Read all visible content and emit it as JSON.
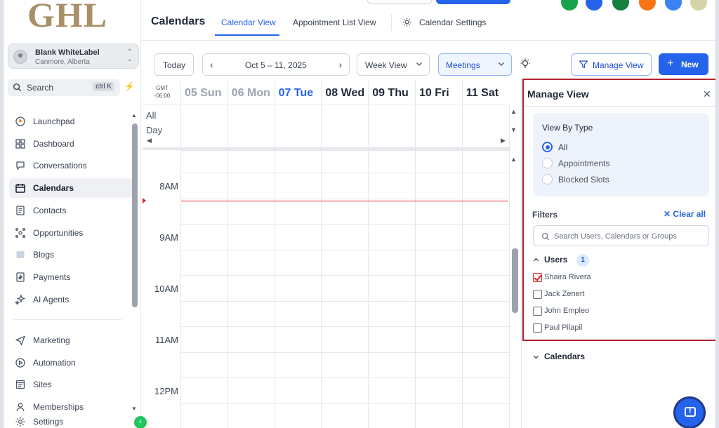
{
  "brand": {
    "logo_text": "GHL"
  },
  "account": {
    "name": "Blank WhiteLabel",
    "location": "Canmore, Alberta"
  },
  "search": {
    "label": "Search",
    "shortcut": "ctrl K"
  },
  "sidebar": {
    "items": [
      {
        "label": "Launchpad",
        "icon": "rocket-icon"
      },
      {
        "label": "Dashboard",
        "icon": "grid-icon"
      },
      {
        "label": "Conversations",
        "icon": "chat-bubble-icon"
      },
      {
        "label": "Calendars",
        "icon": "calendar-icon",
        "active": true
      },
      {
        "label": "Contacts",
        "icon": "contacts-icon"
      },
      {
        "label": "Opportunities",
        "icon": "opportunities-icon"
      },
      {
        "label": "Blogs",
        "icon": "blog-icon"
      },
      {
        "label": "Payments",
        "icon": "payments-icon"
      },
      {
        "label": "AI Agents",
        "icon": "sparkle-icon"
      }
    ],
    "items2": [
      {
        "label": "Marketing",
        "icon": "send-icon"
      },
      {
        "label": "Automation",
        "icon": "automation-icon"
      },
      {
        "label": "Sites",
        "icon": "sites-icon"
      },
      {
        "label": "Memberships",
        "icon": "memberships-icon"
      },
      {
        "label": "Settings",
        "icon": "gear-icon"
      }
    ]
  },
  "header": {
    "title": "Calendars",
    "tabs": [
      {
        "label": "Calendar View",
        "active": true
      },
      {
        "label": "Appointment List View"
      },
      {
        "label": "Calendar Settings"
      }
    ]
  },
  "toolbar": {
    "today": "Today",
    "date_range": "Oct 5 – 11, 2025",
    "view": "Week View",
    "filter": "Meetings",
    "manage_view": "Manage View",
    "new": "New"
  },
  "calendar": {
    "timezone_line1": "GMT",
    "timezone_line2": "-06:00",
    "days": [
      {
        "label": "05 Sun",
        "state": "past"
      },
      {
        "label": "06 Mon",
        "state": "past"
      },
      {
        "label": "07 Tue",
        "state": "today"
      },
      {
        "label": "08 Wed",
        "state": ""
      },
      {
        "label": "09 Thu",
        "state": ""
      },
      {
        "label": "10 Fri",
        "state": ""
      },
      {
        "label": "11 Sat",
        "state": ""
      }
    ],
    "all_day_line1": "All",
    "all_day_line2": "Day",
    "hours": [
      "8AM",
      "9AM",
      "10AM",
      "11AM",
      "12PM"
    ]
  },
  "manage_view": {
    "title": "Manage View",
    "view_by_type": "View By Type",
    "types": [
      {
        "label": "All",
        "selected": true
      },
      {
        "label": "Appointments",
        "selected": false
      },
      {
        "label": "Blocked Slots",
        "selected": false
      }
    ],
    "filters_label": "Filters",
    "clear_all": "Clear all",
    "search_placeholder": "Search Users, Calendars or Groups",
    "users_label": "Users",
    "users_count": "1",
    "users": [
      {
        "name": "Shaira Rivera",
        "checked": true
      },
      {
        "name": "Jack Zenert",
        "checked": false
      },
      {
        "name": "John Empleo",
        "checked": false
      },
      {
        "name": "Paul Pilapil",
        "checked": false
      }
    ],
    "calendars_label": "Calendars"
  },
  "colors": {
    "accent": "#2563eb",
    "highlight_border": "#b42330",
    "logo": "#a89068",
    "now_line": "#dc2626",
    "top_circles": [
      "#16a34a",
      "#2563eb",
      "#15803d",
      "#f97316",
      "#3b82f6",
      "#d4d4a8"
    ]
  }
}
